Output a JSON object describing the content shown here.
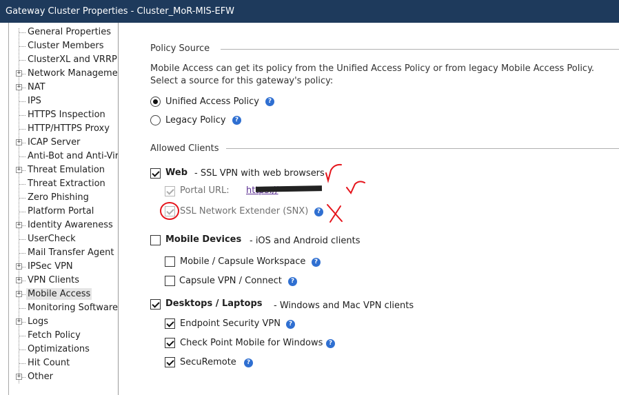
{
  "window": {
    "title": "Gateway Cluster Properties - Cluster_MoR-MIS-EFW"
  },
  "tree": {
    "items": [
      {
        "label": "General Properties",
        "expandable": false,
        "selected": false
      },
      {
        "label": "Cluster Members",
        "expandable": false,
        "selected": false
      },
      {
        "label": "ClusterXL and VRRP",
        "expandable": false,
        "selected": false
      },
      {
        "label": "Network Management",
        "expandable": true,
        "selected": false
      },
      {
        "label": "NAT",
        "expandable": true,
        "selected": false
      },
      {
        "label": "IPS",
        "expandable": false,
        "selected": false
      },
      {
        "label": "HTTPS Inspection",
        "expandable": false,
        "selected": false
      },
      {
        "label": "HTTP/HTTPS Proxy",
        "expandable": false,
        "selected": false
      },
      {
        "label": "ICAP Server",
        "expandable": true,
        "selected": false
      },
      {
        "label": "Anti-Bot and Anti-Virus",
        "expandable": false,
        "selected": false
      },
      {
        "label": "Threat Emulation",
        "expandable": true,
        "selected": false
      },
      {
        "label": "Threat Extraction",
        "expandable": false,
        "selected": false
      },
      {
        "label": "Zero Phishing",
        "expandable": false,
        "selected": false
      },
      {
        "label": "Platform Portal",
        "expandable": false,
        "selected": false
      },
      {
        "label": "Identity Awareness",
        "expandable": true,
        "selected": false
      },
      {
        "label": "UserCheck",
        "expandable": false,
        "selected": false
      },
      {
        "label": "Mail Transfer Agent",
        "expandable": false,
        "selected": false
      },
      {
        "label": "IPSec VPN",
        "expandable": true,
        "selected": false
      },
      {
        "label": "VPN Clients",
        "expandable": true,
        "selected": false
      },
      {
        "label": "Mobile Access",
        "expandable": true,
        "selected": true
      },
      {
        "label": "Monitoring Software b",
        "expandable": false,
        "selected": false
      },
      {
        "label": "Logs",
        "expandable": true,
        "selected": false
      },
      {
        "label": "Fetch Policy",
        "expandable": false,
        "selected": false
      },
      {
        "label": "Optimizations",
        "expandable": false,
        "selected": false
      },
      {
        "label": "Hit Count",
        "expandable": false,
        "selected": false
      },
      {
        "label": "Other",
        "expandable": true,
        "selected": false
      }
    ],
    "expand_glyph": "+"
  },
  "policy_source": {
    "heading": "Policy Source",
    "description_line1": "Mobile Access can get its policy from the Unified Access Policy or from legacy Mobile Access Policy.",
    "description_line2": "Select a source for this gateway's policy:",
    "unified_label": "Unified Access Policy",
    "legacy_label": "Legacy Policy",
    "selected": "unified"
  },
  "allowed_clients": {
    "heading": "Allowed Clients",
    "web": {
      "label": "Web",
      "desc": "- SSL VPN with web browsers",
      "checked": true
    },
    "portal_url": {
      "label": "Portal URL:",
      "value": "https://",
      "checked": true,
      "disabled": true
    },
    "snx": {
      "label": "SSL Network Extender (SNX)",
      "checked": true,
      "disabled": true
    },
    "mobile_devices": {
      "label": "Mobile Devices",
      "desc": "- iOS and Android clients",
      "checked": false
    },
    "mobile_capsule": {
      "label": "Mobile / Capsule Workspace",
      "checked": false
    },
    "capsule_vpn": {
      "label": "Capsule VPN / Connect",
      "checked": false
    },
    "desktops": {
      "label": "Desktops / Laptops",
      "desc": "- Windows and Mac VPN clients",
      "checked": true
    },
    "endpoint": {
      "label": "Endpoint Security VPN",
      "checked": true
    },
    "cpmobile": {
      "label": "Check Point Mobile for Windows",
      "checked": true
    },
    "securemote": {
      "label": "SecuRemote",
      "checked": true
    }
  },
  "help_glyph": "?",
  "colors": {
    "titlebar": "#1e3a5c",
    "help": "#2f6fd1",
    "link": "#5a2d91",
    "annotation": "#e5141b"
  }
}
